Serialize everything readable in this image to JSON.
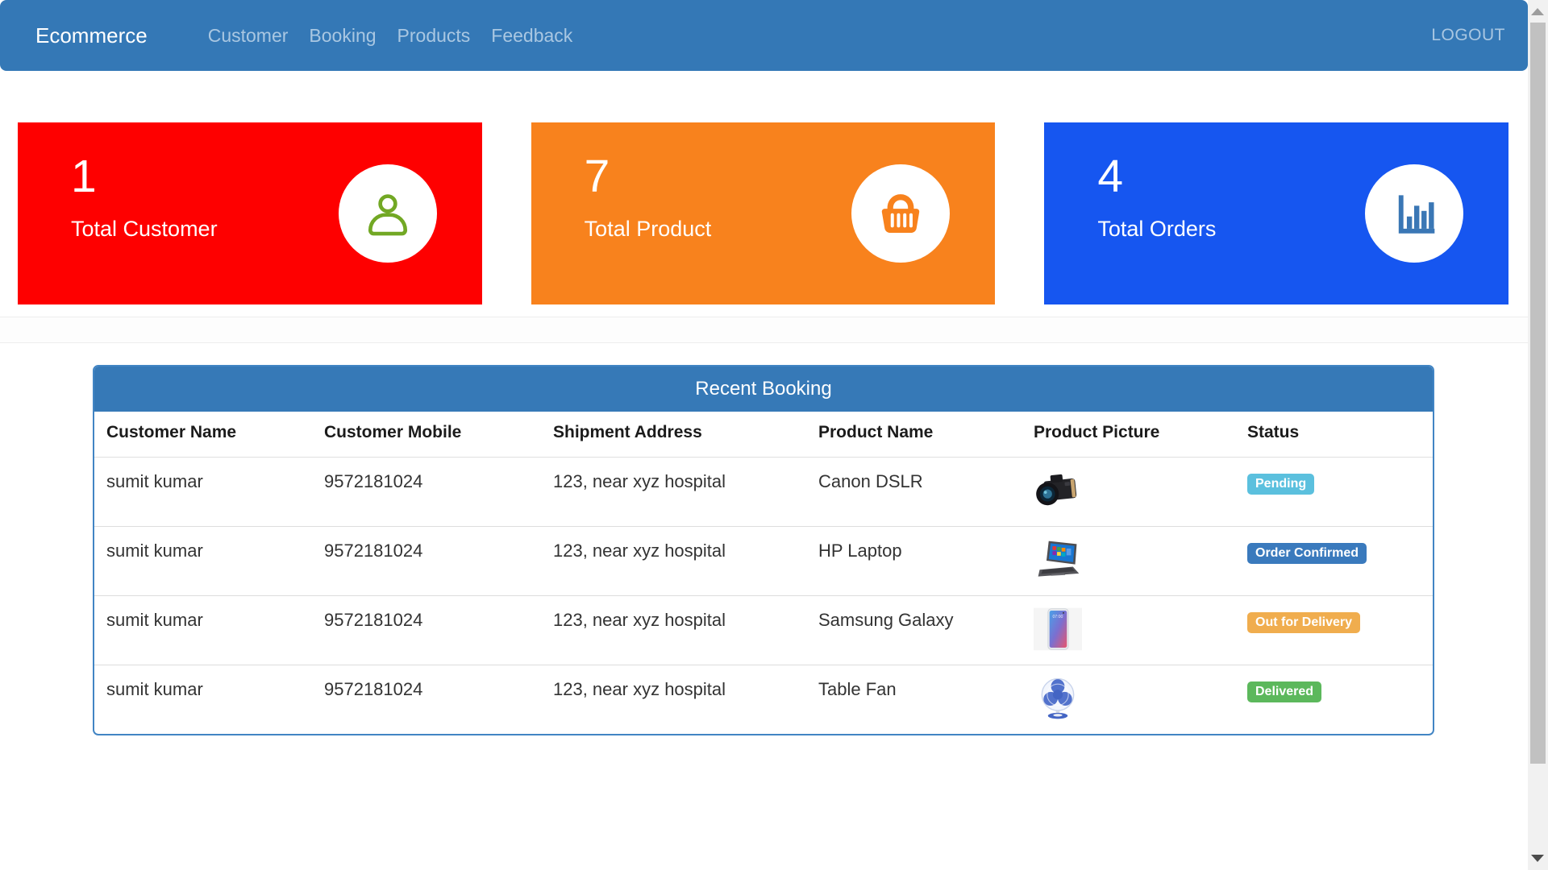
{
  "navbar": {
    "brand": "Ecommerce",
    "links": [
      {
        "label": "Customer"
      },
      {
        "label": "Booking"
      },
      {
        "label": "Products"
      },
      {
        "label": "Feedback"
      }
    ],
    "logout_label": "LOGOUT",
    "bg_color": "#3478b6"
  },
  "stats": [
    {
      "value": "1",
      "label": "Total Customer",
      "bg_color": "#fe0000",
      "icon": "person-icon",
      "icon_color": "#72a824"
    },
    {
      "value": "7",
      "label": "Total Product",
      "bg_color": "#f8821d",
      "icon": "basket-icon",
      "icon_color": "#f8821d"
    },
    {
      "value": "4",
      "label": "Total Orders",
      "bg_color": "#1656f0",
      "icon": "bar-chart-icon",
      "icon_color": "#3a77b5"
    }
  ],
  "panel": {
    "title": "Recent Booking",
    "header_bg": "#3679b7",
    "columns": [
      "Customer Name",
      "Customer Mobile",
      "Shipment Address",
      "Product Name",
      "Product Picture",
      "Status"
    ],
    "rows": [
      {
        "customer_name": "sumit kumar",
        "customer_mobile": "9572181024",
        "shipment_address": "123, near xyz hospital",
        "product_name": "Canon DSLR",
        "product_picture": "camera-photo",
        "status": "Pending",
        "status_color": "#5bc0de"
      },
      {
        "customer_name": "sumit kumar",
        "customer_mobile": "9572181024",
        "shipment_address": "123, near xyz hospital",
        "product_name": "HP Laptop",
        "product_picture": "laptop-photo",
        "status": "Order Confirmed",
        "status_color": "#3a7abd"
      },
      {
        "customer_name": "sumit kumar",
        "customer_mobile": "9572181024",
        "shipment_address": "123, near xyz hospital",
        "product_name": "Samsung Galaxy",
        "product_picture": "phone-photo",
        "status": "Out for Delivery",
        "status_color": "#f0ad4e"
      },
      {
        "customer_name": "sumit kumar",
        "customer_mobile": "9572181024",
        "shipment_address": "123, near xyz hospital",
        "product_name": "Table Fan",
        "product_picture": "fan-photo",
        "status": "Delivered",
        "status_color": "#5cb85c"
      }
    ]
  }
}
